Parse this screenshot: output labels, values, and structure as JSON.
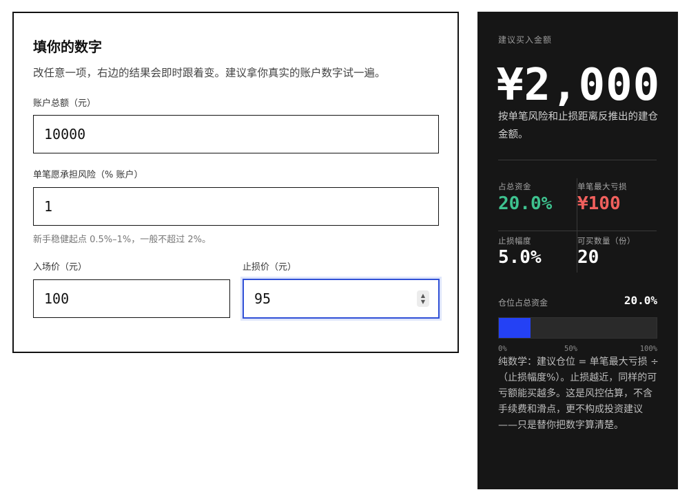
{
  "form": {
    "title": "填你的数字",
    "subtitle": "改任意一项，右边的结果会即时跟着变。建议拿你真实的账户数字试一遍。",
    "account": {
      "label": "账户总额（元）",
      "value": "10000"
    },
    "risk": {
      "label": "单笔愿承担风险（% 账户）",
      "value": "1",
      "hint": "新手稳健起点 0.5%–1%，一般不超过 2%。"
    },
    "entry": {
      "label": "入场价（元）",
      "value": "100"
    },
    "stop": {
      "label": "止损价（元）",
      "value": "95"
    }
  },
  "result": {
    "label": "建议买入金额",
    "amount": "¥2,000",
    "amount_desc": "按单笔风险和止损距离反推出的建仓金额。",
    "stats": [
      {
        "label": "占总资金",
        "value": "20.0%",
        "color": "#3ec28f"
      },
      {
        "label": "单笔最大亏损",
        "value": "¥100",
        "color": "#f0605d"
      },
      {
        "label": "止损幅度",
        "value": "5.0%",
        "color": "#ffffff"
      },
      {
        "label": "可买数量（份）",
        "value": "20",
        "color": "#ffffff"
      }
    ],
    "bar": {
      "label": "仓位占总资金",
      "value_text": "20.0%",
      "fraction": 0.2,
      "ticks": [
        "0%",
        "50%",
        "100%"
      ],
      "fill_color": "#2441f5"
    },
    "explanation": "纯数学：建议仓位 = 单笔最大亏损 ÷（止损幅度%）。止损越近，同样的可亏额能买越多。这是风控估算，不含手续费和滑点，更不构成投资建议——只是替你把数字算清楚。"
  }
}
